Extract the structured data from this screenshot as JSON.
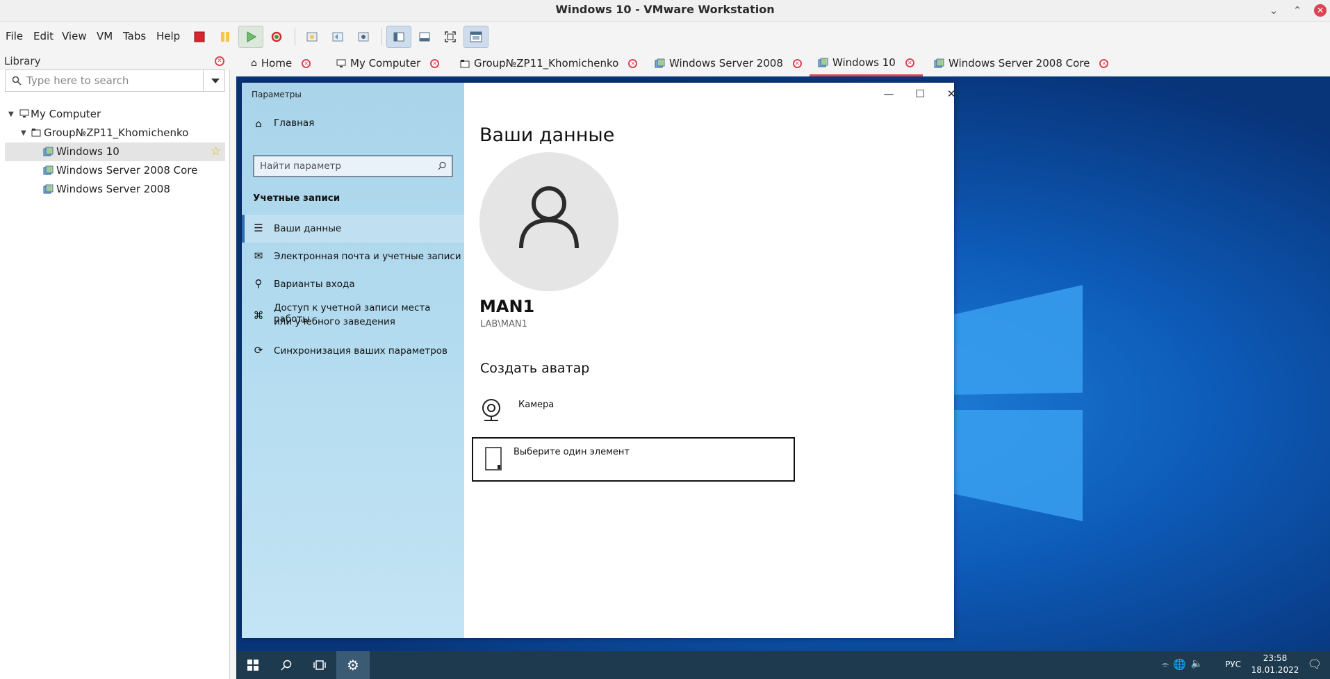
{
  "window": {
    "title": "Windows 10 - VMware Workstation"
  },
  "menubar": {
    "items": [
      "File",
      "Edit",
      "View",
      "VM",
      "Tabs",
      "Help"
    ]
  },
  "library": {
    "title": "Library",
    "search_placeholder": "Type here to search",
    "tree": [
      {
        "label": "My Computer",
        "level": 0
      },
      {
        "label": "Group№ZP11_Khomichenko",
        "level": 1
      },
      {
        "label": "Windows 10",
        "level": 2,
        "selected": true,
        "favorite": true
      },
      {
        "label": "Windows Server 2008 Core",
        "level": 2
      },
      {
        "label": "Windows Server 2008",
        "level": 2
      }
    ]
  },
  "tabs": [
    {
      "label": "Home",
      "icon": "home-icon"
    },
    {
      "label": "My Computer",
      "icon": "monitor-icon"
    },
    {
      "label": "Group№ZP11_Khomichenko",
      "icon": "folder-icon"
    },
    {
      "label": "Windows Server 2008",
      "icon": "vm-icon"
    },
    {
      "label": "Windows 10",
      "icon": "vm-icon",
      "active": true
    },
    {
      "label": "Windows Server 2008 Core",
      "icon": "vm-icon"
    }
  ],
  "settings": {
    "title": "Параметры",
    "home_label": "Главная",
    "search_placeholder": "Найти параметр",
    "section": "Учетные записи",
    "nav": [
      {
        "label": "Ваши данные",
        "icon": "person-list-icon",
        "selected": true
      },
      {
        "label": "Электронная почта и учетные записи",
        "icon": "mail-icon"
      },
      {
        "label": "Варианты входа",
        "icon": "key-icon"
      },
      {
        "label_line1": "Доступ к учетной записи места работы",
        "label_line2": "или учебного заведения",
        "icon": "briefcase-icon"
      },
      {
        "label": "Синхронизация ваших параметров",
        "icon": "sync-icon"
      }
    ],
    "page_heading": "Ваши данные",
    "username": "MAN1",
    "account_id": "LAB\\MAN1",
    "create_avatar_heading": "Создать аватар",
    "camera_label": "Камера",
    "choose_label": "Выберите один элемент"
  },
  "taskbar": {
    "language": "РУС",
    "time": "23:58",
    "date": "18.01.2022"
  },
  "colors": {
    "accent_red": "#da4453",
    "taskbar": "#1e3a4e",
    "settings_nav": "#b4dcf0"
  }
}
